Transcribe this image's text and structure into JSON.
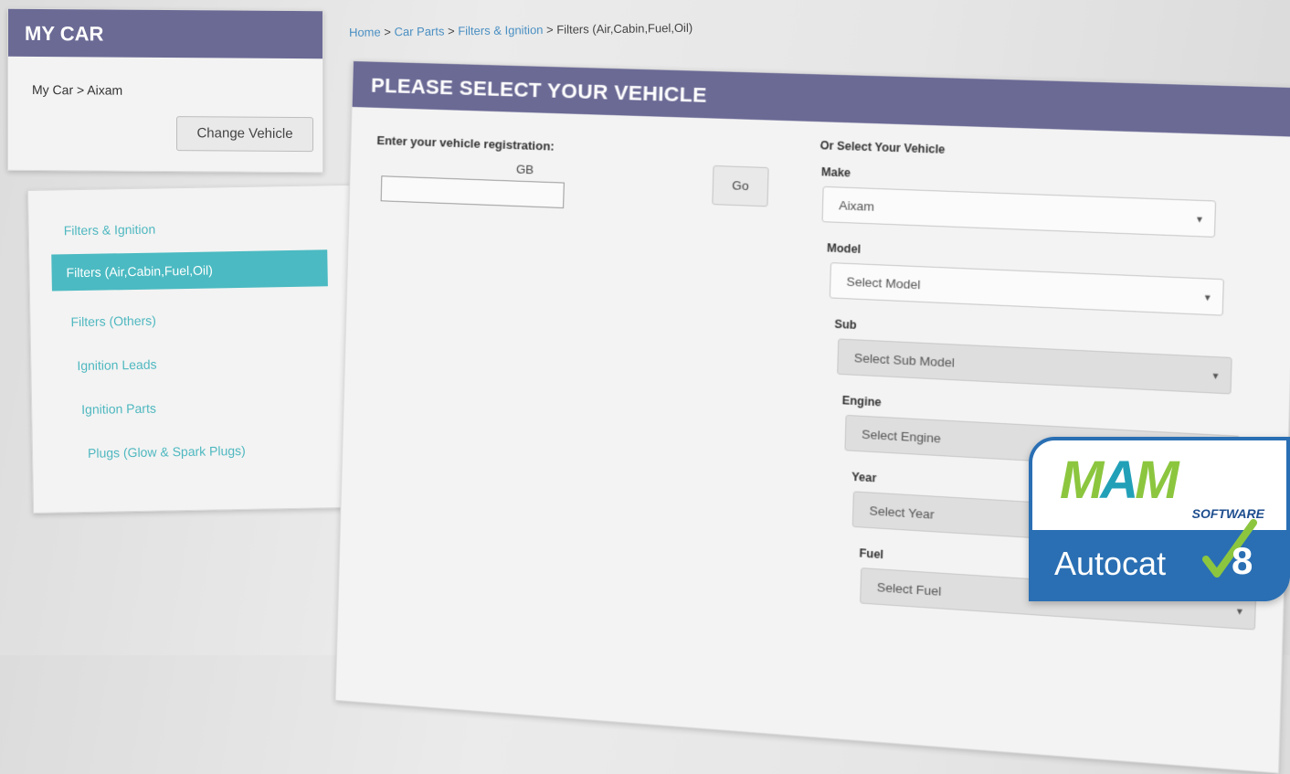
{
  "my_car": {
    "title": "MY CAR",
    "breadcrumb": "My Car > Aixam",
    "change_button": "Change Vehicle"
  },
  "categories": {
    "items": [
      {
        "label": "Filters & Ignition"
      },
      {
        "label": "Filters (Air,Cabin,Fuel,Oil)",
        "active": true
      },
      {
        "label": "Filters (Others)"
      },
      {
        "label": "Ignition Leads"
      },
      {
        "label": "Ignition Parts"
      },
      {
        "label": "Plugs (Glow & Spark Plugs)"
      }
    ]
  },
  "breadcrumb": {
    "items": [
      "Home",
      "Car Parts",
      "Filters & Ignition",
      "Filters (Air,Cabin,Fuel,Oil)"
    ],
    "separator": ">"
  },
  "vehicle_panel": {
    "title": "PLEASE SELECT YOUR VEHICLE",
    "registration_label": "Enter your vehicle registration:",
    "country_code": "GB",
    "registration_value": "",
    "go_button": "Go",
    "or_select_label": "Or Select Your Vehicle",
    "fields": [
      {
        "label": "Make",
        "value": "Aixam",
        "disabled": false
      },
      {
        "label": "Model",
        "value": "Select Model",
        "disabled": false
      },
      {
        "label": "Sub",
        "value": "Select Sub Model",
        "disabled": true
      },
      {
        "label": "Engine",
        "value": "Select Engine",
        "disabled": true
      },
      {
        "label": "Year",
        "value": "Select Year",
        "disabled": true
      },
      {
        "label": "Fuel",
        "value": "Select Fuel",
        "disabled": true
      }
    ]
  },
  "logo": {
    "brand": "MAM",
    "brand_sub": "SOFTWARE",
    "product": "Autocat",
    "version": "8",
    "colors": {
      "blue": "#2a6fb3",
      "green": "#8cc63f",
      "teal": "#22a0b8"
    }
  },
  "colors": {
    "header_bg": "#6b6a95",
    "accent_teal": "#4bbac2",
    "link_blue": "#4a8fc2"
  }
}
